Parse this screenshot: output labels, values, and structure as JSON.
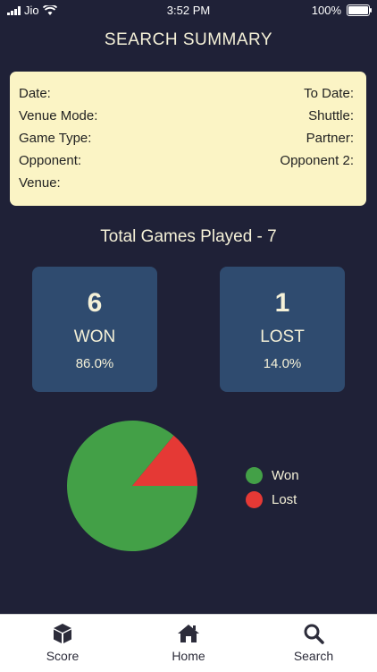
{
  "status_bar": {
    "carrier": "Jio",
    "time": "3:52 PM",
    "battery": "100%"
  },
  "header": {
    "title": "SEARCH SUMMARY"
  },
  "summary": {
    "date_label": "Date:",
    "to_date_label": "To Date:",
    "venue_mode_label": "Venue Mode:",
    "shuttle_label": "Shuttle:",
    "game_type_label": "Game Type:",
    "partner_label": "Partner:",
    "opponent_label": "Opponent:",
    "opponent2_label": "Opponent 2:",
    "venue_label": "Venue:"
  },
  "totals": {
    "text": "Total Games Played - 7"
  },
  "won_card": {
    "count": "6",
    "label": "WON",
    "percent": "86.0%"
  },
  "lost_card": {
    "count": "1",
    "label": "LOST",
    "percent": "14.0%"
  },
  "colors": {
    "won": "#43a047",
    "lost": "#e53935"
  },
  "chart_data": {
    "type": "pie",
    "categories": [
      "Won",
      "Lost"
    ],
    "values": [
      86.0,
      14.0
    ],
    "legend": "right"
  },
  "tabbar": {
    "items": [
      {
        "label": "Score",
        "icon": "cube-icon"
      },
      {
        "label": "Home",
        "icon": "home-icon"
      },
      {
        "label": "Search",
        "icon": "search-icon"
      }
    ]
  }
}
